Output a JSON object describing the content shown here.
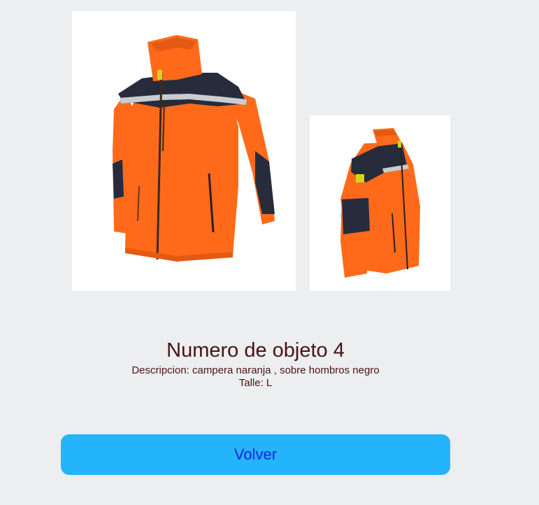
{
  "product": {
    "title": "Numero de objeto 4",
    "description": "Descripcion: campera naranja , sobre hombros negro",
    "size": "Talle: L"
  },
  "images": {
    "main_alt": "orange-fleece-jacket-front-image",
    "side_alt": "orange-fleece-jacket-side-image"
  },
  "actions": {
    "back_label": "Volver"
  },
  "colors": {
    "page_background": "#eceef0",
    "text": "#4a1313",
    "button_background": "#24b4fc",
    "button_text": "#1a22e0",
    "jacket_orange": "#ff6a1a",
    "jacket_navy": "#262c3c",
    "reflective_stripe": "#c9ccd0"
  }
}
